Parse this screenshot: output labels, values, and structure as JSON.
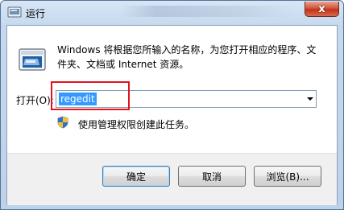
{
  "window": {
    "title": "运行",
    "close_glyph": "x"
  },
  "dialog": {
    "description": "Windows 将根据您所输入的名称，为您打开相应的程序、文件夹、文档或 Internet 资源。",
    "open_label": "打开(O):",
    "input_value": "regedit",
    "admin_note": "使用管理权限创建此任务。"
  },
  "buttons": {
    "ok": "确定",
    "cancel": "取消",
    "browse": "浏览(B)..."
  },
  "colors": {
    "selection": "#3399ff",
    "highlight_box": "#e0141e",
    "close_button": "#c0321b"
  },
  "icons": {
    "title": "run-icon",
    "main": "run-icon",
    "admin": "uac-shield-icon",
    "dropdown": "chevron-down-icon"
  }
}
